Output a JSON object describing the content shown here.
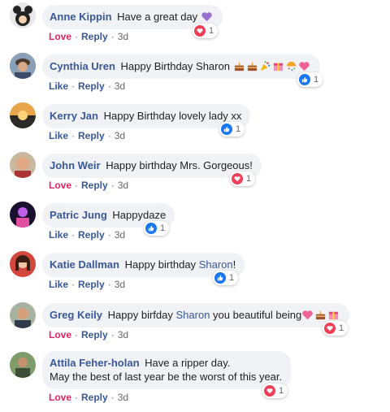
{
  "comments": [
    {
      "author": "Anne Kippin",
      "segments": [
        "Have a great day"
      ],
      "emojis": [
        "purple-heart"
      ],
      "reaction_type": "love",
      "action": "Love",
      "reply": "Reply",
      "time": "3d",
      "reaction_count": "1"
    },
    {
      "author": "Cynthia Uren",
      "segments": [
        "Happy Birthday Sharon"
      ],
      "emojis": [
        "cake",
        "cake",
        "party-popper",
        "gift",
        "confetti-ball",
        "sparkling-heart"
      ],
      "reaction_type": "like",
      "action": "Like",
      "reply": "Reply",
      "time": "3d",
      "reaction_count": "1"
    },
    {
      "author": "Kerry Jan",
      "segments": [
        "Happy Birthday lovely lady xx"
      ],
      "emojis": [],
      "reaction_type": "like",
      "action": "Like",
      "reply": "Reply",
      "time": "3d",
      "reaction_count": "1"
    },
    {
      "author": "John Weir",
      "segments": [
        "Happy birthday Mrs. Gorgeous!"
      ],
      "emojis": [],
      "reaction_type": "love",
      "action": "Love",
      "reply": "Reply",
      "time": "3d",
      "reaction_count": "1"
    },
    {
      "author": "Patric Jung",
      "segments": [
        "Happydaze"
      ],
      "emojis": [],
      "reaction_type": "like",
      "action": "Like",
      "reply": "Reply",
      "time": "3d",
      "reaction_count": "1"
    },
    {
      "author": "Katie Dallman",
      "segments": [
        "Happy birthday",
        "Sharon",
        "!"
      ],
      "emojis": [],
      "reaction_type": "like",
      "action": "Like",
      "reply": "Reply",
      "time": "3d",
      "reaction_count": "1"
    },
    {
      "author": "Greg Keily",
      "segments": [
        "Happy birfday",
        "Sharon",
        "you beautiful being"
      ],
      "emojis": [
        "sparkling-heart",
        "cake",
        "gift"
      ],
      "reaction_type": "love",
      "action": "Love",
      "reply": "Reply",
      "time": "3d",
      "reaction_count": "1"
    },
    {
      "author": "Attila Feher-holan",
      "segments": [
        "Have a ripper day.",
        "May the best of last year be the worst of this year."
      ],
      "emojis": [],
      "reaction_type": "love",
      "action": "Love",
      "reply": "Reply",
      "time": "3d",
      "reaction_count": "1"
    }
  ],
  "colors": {
    "author": "#385898",
    "love": "#e0245e",
    "like": "#385898",
    "bubble": "#f0f2f5",
    "muted": "#65676b"
  }
}
